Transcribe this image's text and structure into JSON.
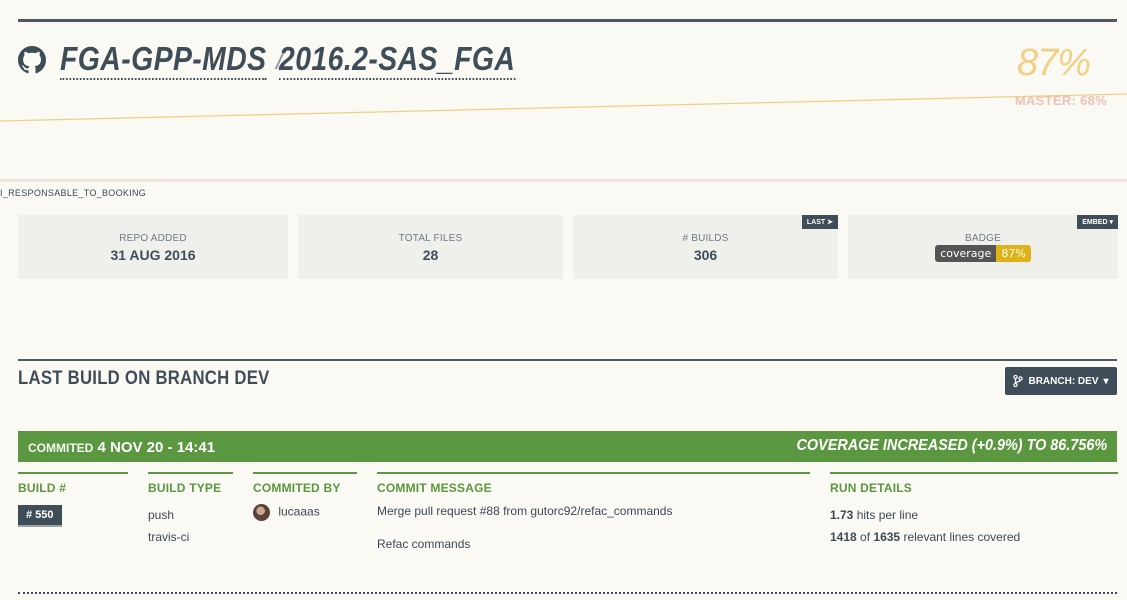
{
  "repo": {
    "owner": "FGA-GPP-MDS",
    "separator": "/",
    "name": "2016.2-SAS_FGA"
  },
  "coverage": {
    "percent": "87%",
    "master": "MASTER: 68%"
  },
  "branch_label": "I_RESPONSABLE_TO_BOOKING",
  "stats": [
    {
      "label": "REPO ADDED",
      "value": "31 AUG 2016"
    },
    {
      "label": "TOTAL FILES",
      "value": "28"
    },
    {
      "label": "# BUILDS",
      "value": "306",
      "button": "LAST"
    },
    {
      "label": "BADGE",
      "button": "EMBED",
      "badge_left": "coverage",
      "badge_right": "87%"
    }
  ],
  "section": {
    "title": "LAST BUILD ON BRANCH DEV",
    "branch_button": "BRANCH: DEV"
  },
  "build": {
    "committed_label": "COMMITED",
    "committed_at": "4 NOV 20 - 14:41",
    "coverage_change": "COVERAGE INCREASED (+0.9%) TO 86.756%",
    "build_number_head": "BUILD #",
    "build_number": "# 550",
    "build_type_head": "BUILD TYPE",
    "build_types": [
      "push",
      "travis-ci"
    ],
    "committed_by_head": "COMMITED BY",
    "committer": "lucaaas",
    "message_head": "COMMIT MESSAGE",
    "message_lines": [
      "Merge pull request #88 from gutorc92/refac_commands",
      "Refac commands"
    ],
    "run_head": "RUN DETAILS",
    "hits_value": "1.73",
    "hits_text": "hits per line",
    "covered": "1418",
    "of_text": "of",
    "relevant": "1635",
    "relevant_text": "relevant lines covered"
  }
}
